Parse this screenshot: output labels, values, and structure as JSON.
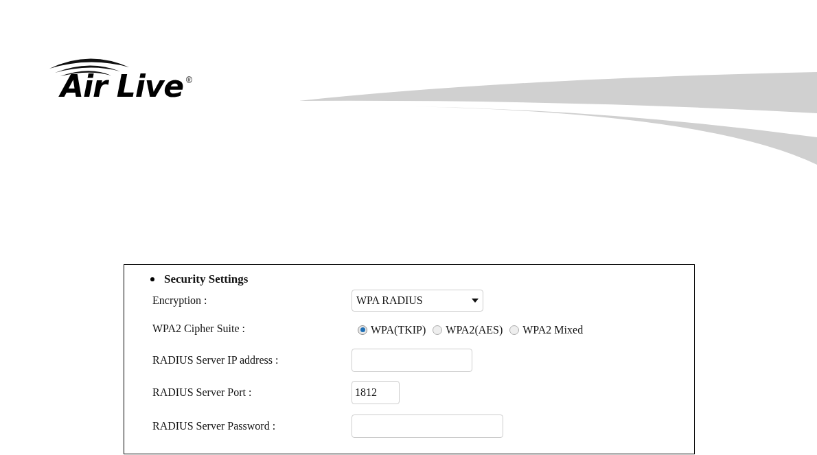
{
  "logo": {
    "text": "Air Live",
    "mark": "®"
  },
  "panel": {
    "title": "Security Settings",
    "rows": [
      {
        "kind": "select",
        "label": "Encryption :",
        "value": "WPA RADIUS"
      },
      {
        "kind": "radio",
        "label": "WPA2 Cipher Suite :",
        "options": [
          {
            "label": "WPA(TKIP)",
            "selected": true
          },
          {
            "label": "WPA2(AES)",
            "selected": false
          },
          {
            "label": "WPA2 Mixed",
            "selected": false
          }
        ]
      },
      {
        "kind": "text",
        "label": "RADIUS Server IP address :",
        "value": ""
      },
      {
        "kind": "text",
        "label": "RADIUS Server Port :",
        "value": "1812"
      },
      {
        "kind": "text",
        "label": "RADIUS Server Password :",
        "value": ""
      }
    ]
  }
}
